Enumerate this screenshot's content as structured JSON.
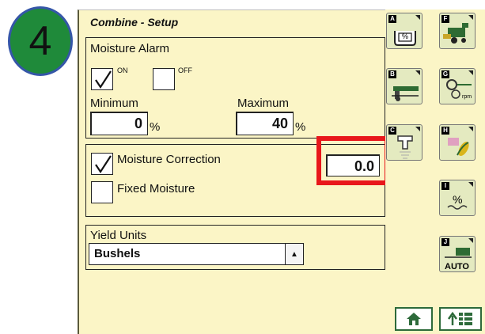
{
  "step_badge": {
    "number": "4"
  },
  "screen": {
    "title": "Combine - Setup"
  },
  "moisture_alarm": {
    "label": "Moisture Alarm",
    "on_label": "ON",
    "off_label": "OFF",
    "on_checked": true,
    "off_checked": false,
    "minimum_label": "Minimum",
    "minimum_value": "0",
    "maximum_label": "Maximum",
    "maximum_value": "40",
    "unit": "%"
  },
  "correction": {
    "moisture_correction_label": "Moisture Correction",
    "moisture_correction_checked": true,
    "moisture_correction_value": "0.0",
    "fixed_moisture_label": "Fixed Moisture",
    "fixed_moisture_checked": false
  },
  "yield_units": {
    "label": "Yield Units",
    "selected": "Bushels"
  },
  "softkeys": [
    {
      "letter": "A",
      "icon": "moisture-percent-icon"
    },
    {
      "letter": "B",
      "icon": "combine-header-icon"
    },
    {
      "letter": "C",
      "icon": "moisture-sensor-icon"
    },
    {
      "letter": "F",
      "icon": "combine-icon"
    },
    {
      "letter": "G",
      "icon": "rotor-speed-icon"
    },
    {
      "letter": "H",
      "icon": "corn-crop-icon"
    },
    {
      "letter": "I",
      "icon": "percent-moisture-icon"
    },
    {
      "letter": "J",
      "icon": "auto-combine-icon"
    }
  ],
  "softkey_j_text": "AUTO",
  "softkey_g_text": "rpm",
  "softkey_a_text": "%",
  "softkey_i_text": "%",
  "nav": {
    "home_icon": "home-icon",
    "menu_icon": "menu-up-icon"
  },
  "colors": {
    "screen_bg": "#fbf5c6",
    "highlight": "#e8171b",
    "badge_fill": "#1f8a3a",
    "badge_border": "#3556a8",
    "button_green": "#2d6a3a"
  }
}
